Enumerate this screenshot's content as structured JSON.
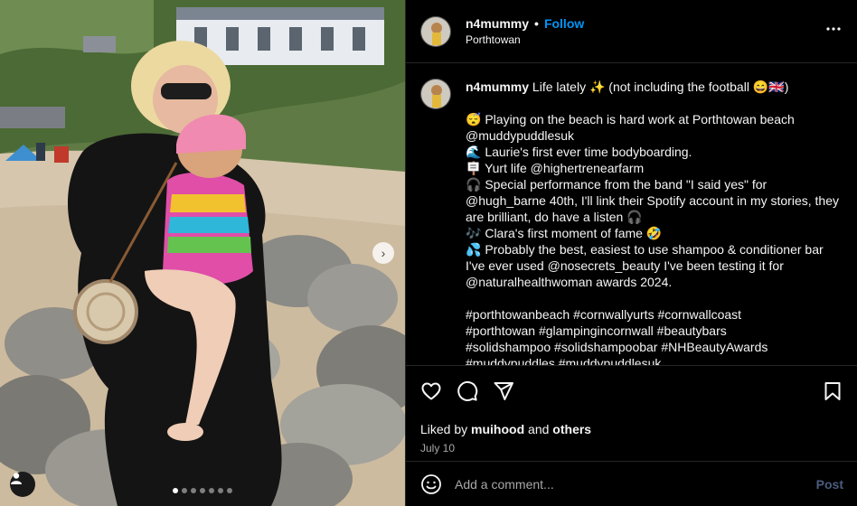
{
  "post": {
    "username": "n4mummy",
    "separator": "•",
    "follow_label": "Follow",
    "location": "Porthtowan",
    "more_icon": "more-horizontal-icon"
  },
  "caption": {
    "username": "n4mummy",
    "intro": "Life lately ✨ (not including the football 😄🇬🇧)",
    "lines": [
      {
        "emoji": "😴",
        "text": "Playing on the beach is hard work at Porthtowan beach @muddypuddlesuk"
      },
      {
        "emoji": "🌊",
        "text": "Laurie's first ever time bodyboarding."
      },
      {
        "emoji": "🪧",
        "text": "Yurt life @highertrenearfarm"
      },
      {
        "emoji": "🎧",
        "text": "Special performance from the band \"I said yes\" for @hugh_barne 40th, I'll link their Spotify account in my stories, they are brilliant, do have a listen 🎧"
      },
      {
        "emoji": "🎶",
        "text": "Clara's first moment of fame 🤣"
      },
      {
        "emoji": "💦",
        "text": "Probably the best, easiest to use shampoo & conditioner bar I've ever used @nosecrets_beauty I've been testing it for @naturalhealthwoman awards 2024."
      }
    ],
    "hashtags": [
      "#porthtowanbeach #cornwallyurts #cornwallcoast",
      "#porthtowan #glampingincornwall #beautybars",
      "#solidshampoo #solidshampoobar #NHBeautyAwards",
      "#muddypuddles #muddypuddlesuk"
    ]
  },
  "actions": {
    "liked_by_prefix": "Liked by",
    "liked_by_user": "muihood",
    "liked_by_and": "and",
    "liked_by_others": "others",
    "date": "July 10"
  },
  "comment": {
    "placeholder": "Add a comment...",
    "post_label": "Post"
  },
  "carousel": {
    "next_label": "›",
    "dot_count": 7,
    "active_index": 0
  },
  "colors": {
    "follow": "#0095f6",
    "background": "#000000",
    "divider": "#262626",
    "post_disabled": "#4a5d7e"
  }
}
